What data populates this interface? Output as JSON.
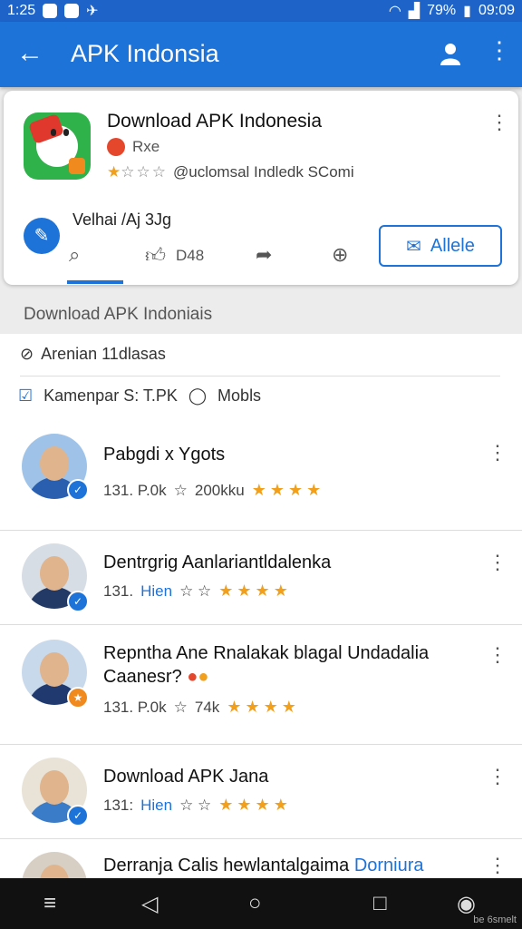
{
  "status_bar": {
    "time": "1:25",
    "battery": "79%",
    "clock": "09:09"
  },
  "app_bar": {
    "title": "APK Indonsia",
    "back_icon": "arrow-left-icon",
    "account_icon": "person-icon",
    "more_icon": "more-vert-icon"
  },
  "app_card": {
    "title": "Download APK Indonesia",
    "developer": "Rxe",
    "rating_text": "@uclomsal Indledk SComi",
    "version": "Velhai /Aj 3Jg",
    "likes": "D48",
    "action_button": "Allele"
  },
  "section_title": "Download APK Indoniais",
  "info": {
    "line1": "Arenian 11dlasas",
    "line2a": "Kamenpar S: T.PK",
    "line2b": "Mobls"
  },
  "results": [
    {
      "title": "Pabgdi x Ygots",
      "meta1": "131. P.0k",
      "meta2": "200kku",
      "avatar_color": "#2a5fb0"
    },
    {
      "title": "Dentrgrig Aanlariantldalenka",
      "meta1": "131.",
      "meta2": "Hien",
      "avatar_color": "#243a66"
    },
    {
      "title": "Repntha Ane Rnalakak blagal Undadalia Caanesr?",
      "meta1": "131. P.0k",
      "meta2": "74k",
      "avatar_color": "#203a70"
    },
    {
      "title": "Download APK Jana",
      "meta1": "131:",
      "meta2": "Hien",
      "avatar_color": "#3a7cc7"
    },
    {
      "title_prefix": "Derranja Calis hewlantalgaima",
      "title_blue": "Dorniura"
    }
  ],
  "footer_text": "be 6smelt"
}
